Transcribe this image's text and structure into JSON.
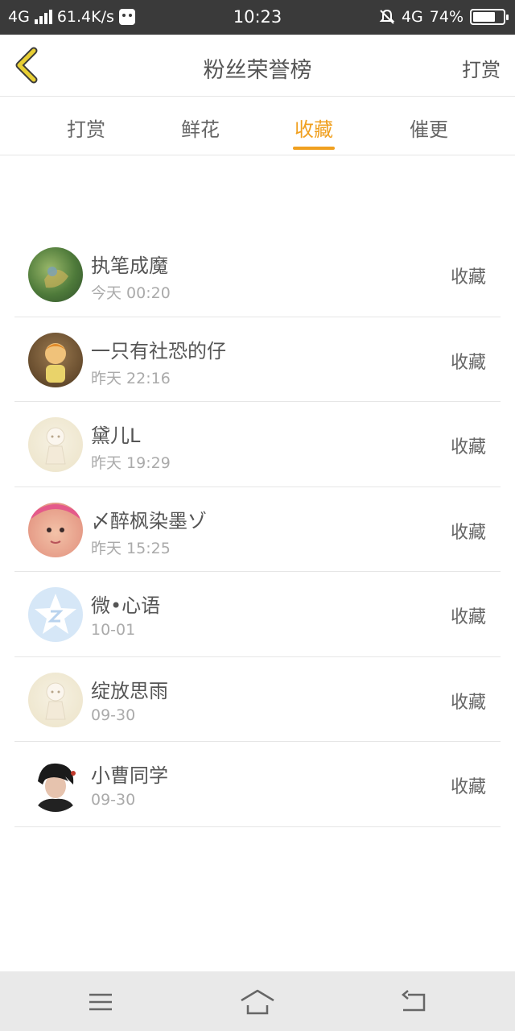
{
  "status_bar": {
    "network": "4G",
    "speed": "61.4K/s",
    "time": "10:23",
    "network_right": "4G",
    "battery_percent": "74%",
    "battery_level": 0.74
  },
  "header": {
    "title": "粉丝荣誉榜",
    "action_label": "打赏",
    "back_icon": "chevron-left-icon"
  },
  "tabs": [
    {
      "label": "打赏",
      "active": false
    },
    {
      "label": "鲜花",
      "active": false
    },
    {
      "label": "收藏",
      "active": true
    },
    {
      "label": "催更",
      "active": false
    }
  ],
  "accent_color": "#f0a020",
  "fans": [
    {
      "name": "执笔成魔",
      "time": "今天 00:20",
      "action": "收藏",
      "avatar": "avatar-green-scene"
    },
    {
      "name": "一只有社恐的仔",
      "time": "昨天 22:16",
      "action": "收藏",
      "avatar": "avatar-cartoon-child"
    },
    {
      "name": "黛儿L",
      "time": "昨天 19:29",
      "action": "收藏",
      "avatar": "avatar-doll"
    },
    {
      "name": "〆醉枫染墨ゾ",
      "time": "昨天 15:25",
      "action": "收藏",
      "avatar": "avatar-baby"
    },
    {
      "name": "微•心语",
      "time": "10-01",
      "action": "收藏",
      "avatar": "avatar-qzone-star"
    },
    {
      "name": "绽放思雨",
      "time": "09-30",
      "action": "收藏",
      "avatar": "avatar-doll"
    },
    {
      "name": "小曹同学",
      "time": "09-30",
      "action": "收藏",
      "avatar": "avatar-dark-anime"
    }
  ],
  "nav_bar": {
    "menu_icon": "menu-icon",
    "home_icon": "home-icon",
    "back_icon": "back-arrow-icon"
  }
}
